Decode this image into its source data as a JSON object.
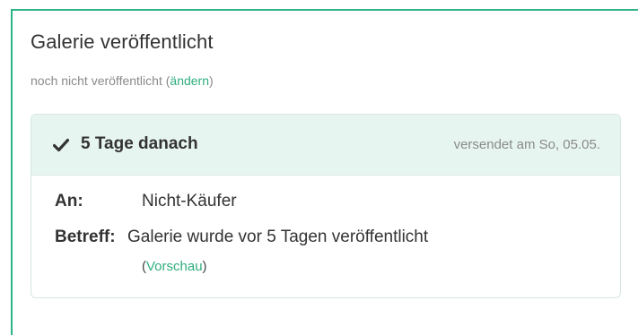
{
  "gallery": {
    "title": "Galerie veröffentlicht",
    "status_text": "noch nicht veröffentlicht",
    "change_link": "ändern"
  },
  "email_card": {
    "icon": "check-icon",
    "title": "5 Tage danach",
    "sent_info": "versendet am So, 05.05.",
    "to_label": "An:",
    "to_value": "Nicht-Käufer",
    "subject_label": "Betreff:",
    "subject_value": "Galerie wurde vor 5 Tagen veröffentlicht",
    "preview_link": "Vorschau"
  },
  "colors": {
    "accent": "#2fae7e",
    "header_bg": "#e7f5f0",
    "muted_text": "#8a8a8a"
  }
}
